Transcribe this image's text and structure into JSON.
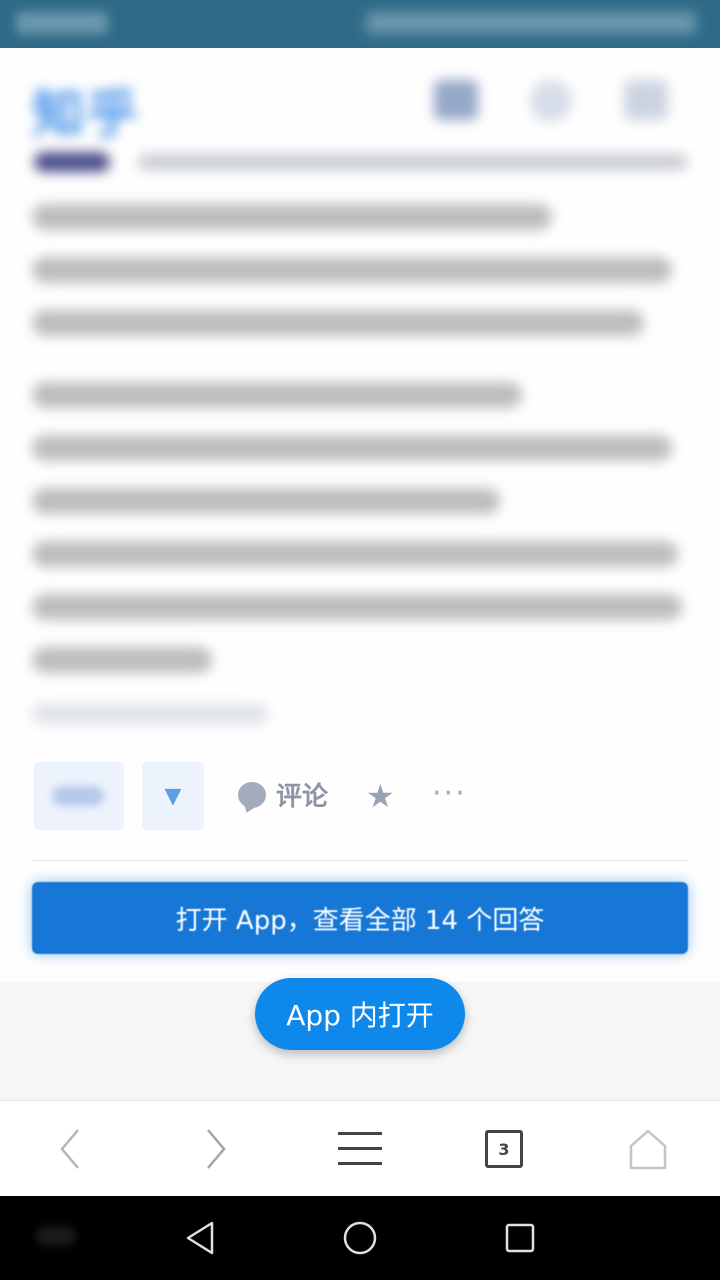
{
  "header": {
    "logo_text": "知乎"
  },
  "actions": {
    "comment_label": "评论",
    "more_label": "···"
  },
  "banner": {
    "open_all_label": "打开 App，查看全部 14 个回答"
  },
  "floating_button": {
    "label": "App 内打开"
  },
  "browser_toolbar": {
    "tab_count": "3"
  },
  "colors": {
    "status_bar": "#2f6b88",
    "primary_blue": "#0f88eb",
    "banner_blue": "#1677d6",
    "nav_bar": "#000000"
  }
}
